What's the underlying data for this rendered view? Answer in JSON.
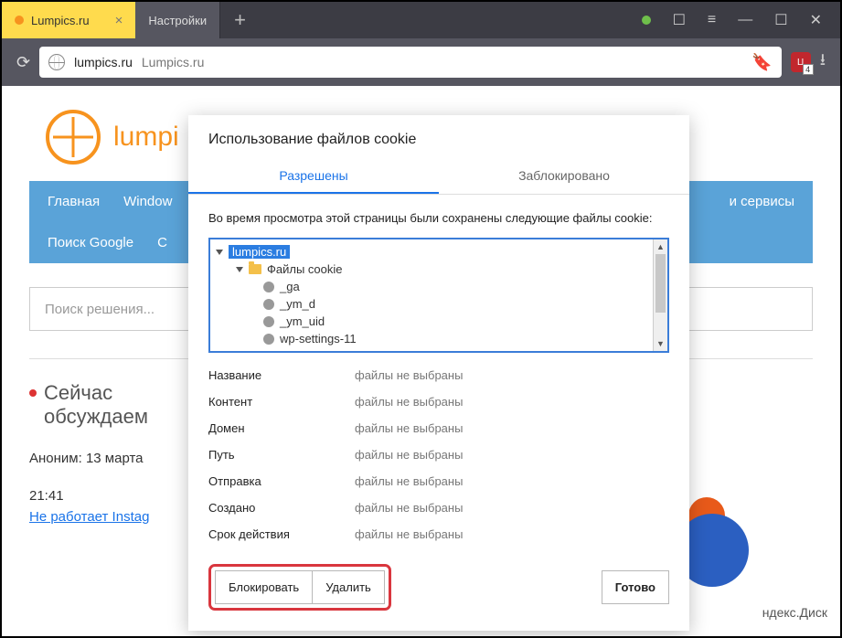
{
  "tabs": {
    "active": "Lumpics.ru",
    "second": "Настройки"
  },
  "addr": {
    "domain": "lumpics.ru",
    "title": "Lumpics.ru"
  },
  "page": {
    "logo": "lumpi",
    "nav1": [
      "Главная",
      "Window"
    ],
    "nav2": [
      "Поиск Google",
      "С"
    ],
    "nav_rest": "и сервисы",
    "search_ph": "Поиск решения...",
    "discuss1": "Сейчас",
    "discuss2": "обсуждаем",
    "anon": "Аноним: 13 марта",
    "anon_time": "21:41",
    "link": "Не работает Instag",
    "yadisk": "ндекс.Диск"
  },
  "dialog": {
    "title": "Использование файлов cookie",
    "tab_allowed": "Разрешены",
    "tab_blocked": "Заблокировано",
    "desc": "Во время просмотра этой страницы были сохранены следующие файлы cookie:",
    "tree": {
      "root": "lumpics.ru",
      "folder": "Файлы cookie",
      "items": [
        "_ga",
        "_ym_d",
        "_ym_uid",
        "wp-settings-11"
      ]
    },
    "labels": {
      "name": "Название",
      "content": "Контент",
      "domain": "Домен",
      "path": "Путь",
      "send": "Отправка",
      "created": "Создано",
      "expires": "Срок действия"
    },
    "nofile": "файлы не выбраны",
    "block": "Блокировать",
    "remove": "Удалить",
    "done": "Готово"
  },
  "ext_badge": "Ц"
}
